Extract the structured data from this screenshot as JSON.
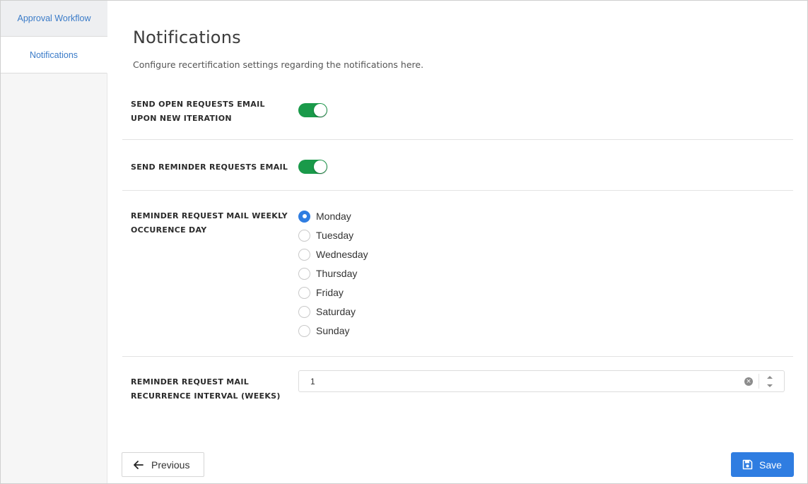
{
  "sidebar": {
    "items": [
      {
        "label": "Approval Workflow"
      },
      {
        "label": "Notifications"
      }
    ]
  },
  "page": {
    "title": "Notifications",
    "subtitle": "Configure recertification settings regarding the notifications here."
  },
  "settings": {
    "open_requests": {
      "label_line1": "SEND OPEN REQUESTS EMAIL",
      "label_line2": "UPON NEW ITERATION",
      "enabled": true
    },
    "reminder_requests": {
      "label": "SEND REMINDER REQUESTS EMAIL",
      "enabled": true
    },
    "weekly_day": {
      "label_line1": "REMINDER REQUEST MAIL WEEKLY",
      "label_line2": "OCCURENCE DAY",
      "options": [
        "Monday",
        "Tuesday",
        "Wednesday",
        "Thursday",
        "Friday",
        "Saturday",
        "Sunday"
      ],
      "selected": "Monday"
    },
    "interval": {
      "label_line1": "REMINDER REQUEST MAIL",
      "label_line2": "RECURRENCE INTERVAL (WEEKS)",
      "value": "1"
    }
  },
  "footer": {
    "previous_label": "Previous",
    "save_label": "Save"
  },
  "colors": {
    "accent": "#2f7de1",
    "toggle_on": "#1a9a4a",
    "link": "#3a7bc8"
  }
}
